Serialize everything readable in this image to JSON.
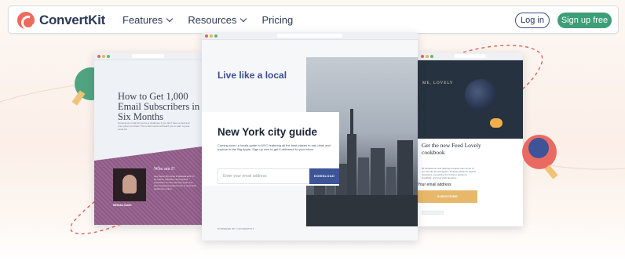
{
  "brand": {
    "name": "ConvertKit",
    "logo_icon": "convertkit-logo-icon",
    "accent": "#ed6a5e"
  },
  "nav": {
    "links": [
      {
        "label": "Features",
        "has_dropdown": true
      },
      {
        "label": "Resources",
        "has_dropdown": true
      },
      {
        "label": "Pricing",
        "has_dropdown": false
      }
    ],
    "login": "Log in",
    "signup": "Sign up free",
    "signup_color": "#3d9e78"
  },
  "cards": {
    "left": {
      "title": "How to Get 1,000 Email Subscribers in Six Months",
      "body": "Growing an email list can be a challenge if you don't have a tried and true system to follow. This email course will teach you to start a great email list",
      "who_heading": "Who am I?",
      "who_text": "Hey there! My name is Melissa and I'm an author, marketer, and content enthusiast. For the last few years I've been teaching creators how to grow their audiences online.",
      "person": "Melissa Cutler"
    },
    "center": {
      "tagline": "Live like a local",
      "title": "New York city guide",
      "body": "Coming soon: a locals guide to NYC featuring all the best places to eat, drink and explore in the Big Apple. Sign up now to get it delivered to your inbox.",
      "input_placeholder": "Enter your email address",
      "button": "DOWNLOAD",
      "footer": "POWERED BY CONVERTKIT"
    },
    "right": {
      "brand": "ME, LOVELY",
      "title": "Get the new Feed Lovely cookbook",
      "body": "50 wholesome and delicious recipes from some of our favorite food bloggers. Includes ideas for perfect occasions, everything from dinner parties to breakfast, and everyday favorites.",
      "input_placeholder": "Your email address",
      "button": "SUBSCRIBE"
    }
  }
}
